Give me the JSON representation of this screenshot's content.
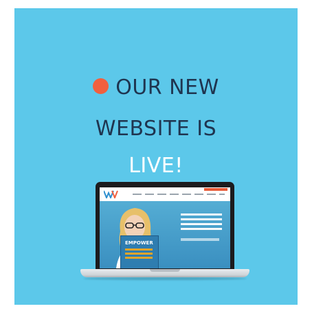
{
  "headline": {
    "line1": "OUR NEW",
    "line2": "WEBSITE IS",
    "line3": "LIVE!"
  },
  "laptop_screen": {
    "book_title": "EMPOWER"
  },
  "colors": {
    "background": "#5cc8ea",
    "dark_text": "#1f3550",
    "accent_dot": "#f0603f",
    "highlight_text": "#ffffff"
  }
}
